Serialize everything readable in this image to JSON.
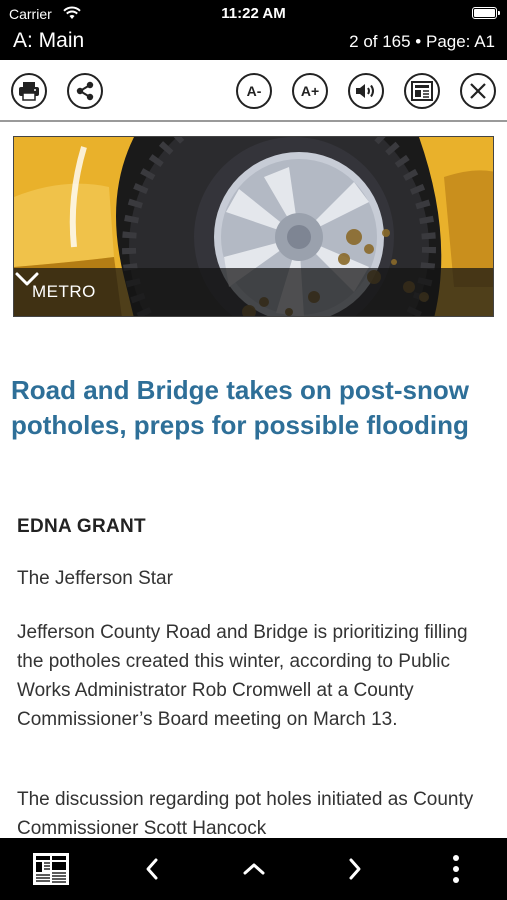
{
  "status_bar": {
    "carrier": "Carrier",
    "time": "11:22 AM"
  },
  "header": {
    "section": "A: Main",
    "page_info": "2 of 165 • Page: A1"
  },
  "toolbar": {
    "font_decrease": "A-",
    "font_increase": "A+",
    "icons": [
      "print-icon",
      "share-icon",
      "font-decrease-icon",
      "font-increase-icon",
      "speaker-icon",
      "article-view-icon",
      "close-icon"
    ]
  },
  "hero": {
    "category": "METRO"
  },
  "article": {
    "headline": "Road and Bridge takes on post-snow potholes, preps for possible flooding",
    "author": "EDNA GRANT",
    "publication": "The Jefferson Star",
    "paragraphs": [
      "Jefferson County Road and Bridge is prioritizing filling the potholes created this winter, according to Public Works Administrator Rob Cromwell at a County Commissioner’s Board meeting on March 13.",
      "The discussion regarding pot holes initiated as County Commissioner Scott Hancock"
    ]
  },
  "bottom_nav": {
    "icons": [
      "pages-grid-icon",
      "previous-icon",
      "up-icon",
      "next-icon",
      "more-icon"
    ]
  },
  "colors": {
    "headline": "#2e6f98",
    "bars": "#000000",
    "car_yellow": "#e9b12b"
  }
}
